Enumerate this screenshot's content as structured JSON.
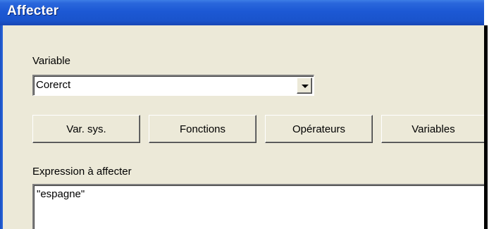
{
  "window": {
    "title": "Affecter"
  },
  "variable": {
    "label": "Variable",
    "selected": "Corerct"
  },
  "buttons": {
    "var_sys": "Var. sys.",
    "fonctions": "Fonctions",
    "operateurs": "Opérateurs",
    "variables": "Variables"
  },
  "expression": {
    "label": "Expression à affecter",
    "value": "\"espagne\""
  },
  "colors": {
    "titlebar": "#1c58d4",
    "dialog_bg": "#ece9d8",
    "field_bg": "#ffffff"
  }
}
